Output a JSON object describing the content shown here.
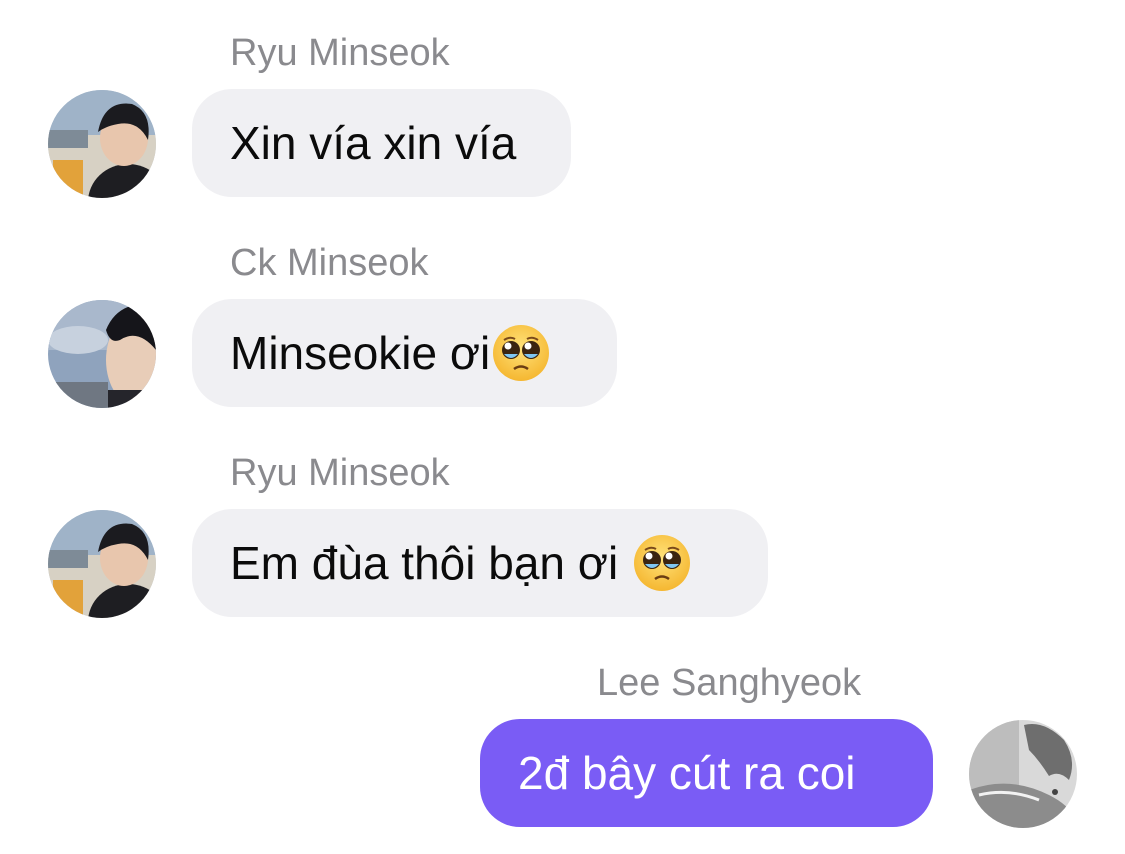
{
  "messages": [
    {
      "sender": "Ryu Minseok",
      "text": "Xin vía xin vía",
      "emoji": "",
      "avatar_icon": "user-avatar-ryu-minseok",
      "direction": "incoming"
    },
    {
      "sender": "Ck Minseok",
      "text": "Minseokie ơi",
      "emoji": "pleading-face-emoji",
      "avatar_icon": "user-avatar-ck-minseok",
      "direction": "incoming"
    },
    {
      "sender": "Ryu Minseok",
      "text": "Em đùa thôi bạn ơi ",
      "emoji": "pleading-face-emoji",
      "avatar_icon": "user-avatar-ryu-minseok",
      "direction": "incoming"
    },
    {
      "sender": "Lee Sanghyeok",
      "text": "2đ bây cút ra coi",
      "emoji": "",
      "avatar_icon": "user-avatar-lee-sanghyeok",
      "direction": "outgoing"
    }
  ],
  "colors": {
    "incoming_bubble": "#f0f0f3",
    "outgoing_bubble": "#7a5cf5",
    "sender_name": "#8a8a8e"
  }
}
